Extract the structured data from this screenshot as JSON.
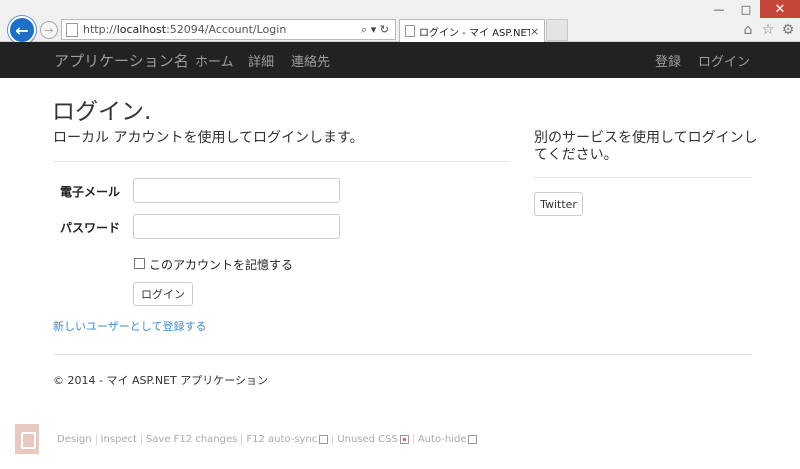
{
  "browser": {
    "url_prefix": "http://",
    "url_host": "localhost",
    "url_rest": ":52094/Account/Login",
    "tab_title": "ログイン - マイ ASP.NET アプ...",
    "tab_close": "×",
    "addr_actions": "⌕ ▾ ↻",
    "win_min": "—",
    "win_max": "□",
    "win_close": "✕",
    "home_icon": "⌂",
    "star_icon": "☆",
    "gear_icon": "⚙"
  },
  "navbar": {
    "brand": "アプリケーション名",
    "links": [
      "ホーム",
      "詳細",
      "連絡先"
    ],
    "right": [
      "登録",
      "ログイン"
    ]
  },
  "page": {
    "title": "ログイン.",
    "local_heading": "ローカル アカウントを使用してログインします。",
    "external_heading": "別のサービスを使用してログインしてください。",
    "email_label": "電子メール",
    "password_label": "パスワード",
    "email_value": "",
    "password_value": "",
    "remember_label": "このアカウントを記憶する",
    "login_button": "ログイン",
    "twitter_button": "Twitter",
    "register_link": "新しいユーザーとして登録する",
    "footer": "© 2014 - マイ ASP.NET アプリケーション"
  },
  "browser_link": {
    "items": [
      "Design",
      "Inspect",
      "Save F12 changes",
      "F12 auto-sync",
      "Unused CSS",
      "Auto-hide"
    ]
  }
}
